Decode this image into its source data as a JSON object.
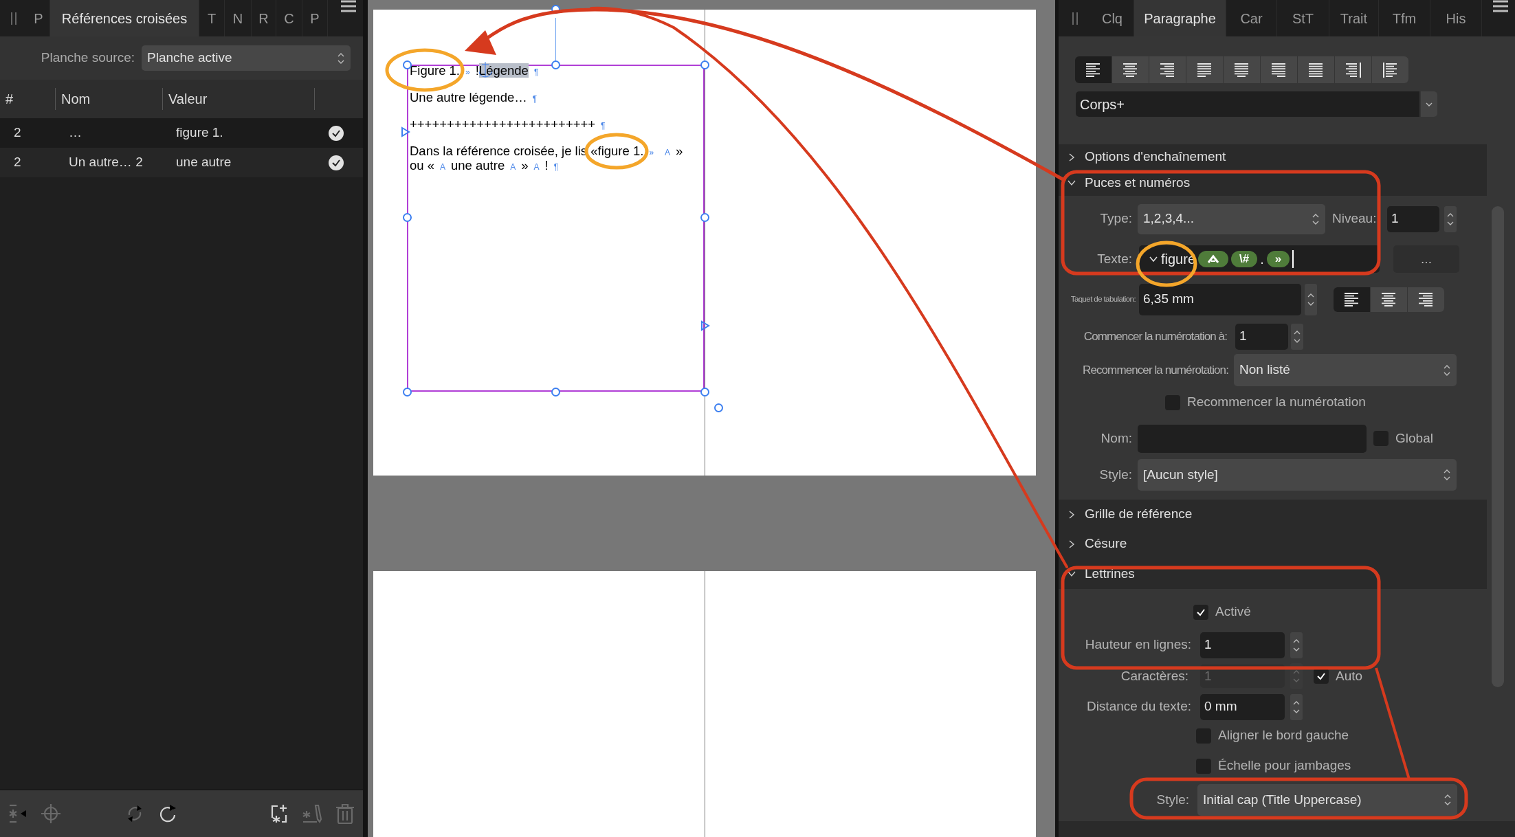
{
  "left_panel": {
    "tabs": [
      {
        "label": "P",
        "selected": false
      },
      {
        "label": "Références croisées",
        "selected": true
      },
      {
        "label": "T",
        "selected": false
      },
      {
        "label": "N",
        "selected": false
      },
      {
        "label": "R",
        "selected": false
      },
      {
        "label": "C",
        "selected": false
      },
      {
        "label": "P",
        "selected": false
      }
    ],
    "source": {
      "label": "Planche source:",
      "value": "Planche active"
    },
    "table": {
      "columns": [
        "#",
        "Nom",
        "Valeur"
      ],
      "rows": [
        {
          "cells": [
            "2",
            "…",
            "figure 1."
          ]
        },
        {
          "cells": [
            "2",
            "Un autre… 2",
            "une autre"
          ]
        }
      ]
    },
    "toolbar": [
      {
        "items": [
          {
            "kind": "insert",
            "disabled": true
          },
          {
            "kind": "target",
            "disabled": true
          }
        ]
      },
      {
        "items": [
          {
            "kind": "sync",
            "disabled": true
          },
          {
            "kind": "refresh",
            "disabled": false
          }
        ]
      },
      {
        "items": [
          {
            "kind": "add",
            "disabled": false
          },
          {
            "kind": "edit",
            "disabled": true
          },
          {
            "kind": "delete",
            "disabled": true
          }
        ]
      }
    ]
  },
  "canvas": {
    "paragraphs": [
      {
        "lines": [
          [
            {
              "kind": "text",
              "text": "Figure 1."
            },
            {
              "kind": "mark",
              "text": "»"
            },
            {
              "kind": "text",
              "text": "!"
            },
            {
              "kind": "highlight",
              "text": "Légende"
            },
            {
              "kind": "mark",
              "text": "¶"
            }
          ]
        ]
      },
      {
        "lines": [
          [
            {
              "kind": "text",
              "text": "Une autre légende…"
            },
            {
              "kind": "mark",
              "text": "¶"
            }
          ]
        ]
      },
      {
        "lines": [
          [
            {
              "kind": "text",
              "text": "+++++++++++++++++++++++++"
            },
            {
              "kind": "mark",
              "text": "¶"
            }
          ]
        ]
      },
      {
        "lines": [
          [
            {
              "kind": "text",
              "text": "Dans la référence croisée, je lis «figure 1."
            },
            {
              "kind": "mark",
              "text": "»"
            },
            {
              "kind": "mark",
              "text": "A"
            },
            {
              "kind": "text",
              "text": "»"
            }
          ],
          [
            {
              "kind": "text",
              "text": "ou «"
            },
            {
              "kind": "mark",
              "text": "A"
            },
            {
              "kind": "text",
              "text": "une autre"
            },
            {
              "kind": "mark",
              "text": "A"
            },
            {
              "kind": "text",
              "text": "»"
            },
            {
              "kind": "mark",
              "text": "A"
            },
            {
              "kind": "text",
              "text": "!"
            },
            {
              "kind": "mark",
              "text": "¶"
            }
          ]
        ]
      }
    ]
  },
  "right_panel": {
    "tabs": [
      {
        "label": "Clq",
        "selected": false
      },
      {
        "label": "Paragraphe",
        "selected": true
      },
      {
        "label": "Car",
        "selected": false
      },
      {
        "label": "StT",
        "selected": false
      },
      {
        "label": "Trait",
        "selected": false
      },
      {
        "label": "Tfm",
        "selected": false
      },
      {
        "label": "His",
        "selected": false
      }
    ],
    "alignment": [
      {
        "kind": "left",
        "selected": true
      },
      {
        "kind": "center",
        "selected": false
      },
      {
        "kind": "right",
        "selected": false
      },
      {
        "kind": "justify-left",
        "selected": false
      },
      {
        "kind": "justify-center",
        "selected": false
      },
      {
        "kind": "justify-right",
        "selected": false
      },
      {
        "kind": "justify-all",
        "selected": false
      },
      {
        "kind": "towards-spine",
        "selected": false
      },
      {
        "kind": "away-from-spine",
        "selected": false
      }
    ],
    "paragraph_style": "Corps+",
    "sections": [
      {
        "title": "Options d'enchaînement",
        "expanded": false
      },
      {
        "title": "Puces et numéros",
        "expanded": true,
        "kind": "bullets"
      },
      {
        "title": "Grille de référence",
        "expanded": false
      },
      {
        "title": "Césure",
        "expanded": false
      },
      {
        "title": "Lettrines",
        "expanded": true,
        "kind": "dropcaps"
      }
    ],
    "bullets": {
      "type": {
        "label": "Type:",
        "value": "1,2,3,4..."
      },
      "level": {
        "label": "Niveau:",
        "value": "1"
      },
      "text": {
        "label": "Texte:",
        "parts": [
          {
            "kind": "text",
            "text": "figure"
          },
          {
            "kind": "field-token"
          },
          {
            "kind": "token",
            "text": "\\#"
          },
          {
            "kind": "text",
            "text": "."
          },
          {
            "kind": "token",
            "text": "»"
          }
        ],
        "more": "..."
      },
      "tab_stop": {
        "label": "Taquet de tabulation:",
        "value": "6,35 mm",
        "alignment": [
          {
            "kind": "left",
            "selected": true
          },
          {
            "kind": "center",
            "selected": false
          },
          {
            "kind": "right",
            "selected": false
          }
        ]
      },
      "start": {
        "label": "Commencer la numérotation à:",
        "value": "1"
      },
      "restart": {
        "label": "Recommencer la numérotation:",
        "value": "Non listé"
      },
      "restart_check": {
        "label": "Recommencer la numérotation",
        "checked": false
      },
      "name": {
        "label": "Nom:"
      },
      "global": {
        "label": "Global",
        "checked": false
      },
      "style": {
        "label": "Style:",
        "value": "[Aucun style]"
      }
    },
    "dropcaps": {
      "enabled": {
        "label": "Activé",
        "checked": true
      },
      "height": {
        "label": "Hauteur en lignes:",
        "value": "1"
      },
      "chars": {
        "label": "Caractères:",
        "value": "1",
        "disabled": true
      },
      "auto": {
        "label": "Auto",
        "checked": true
      },
      "distance": {
        "label": "Distance du texte:",
        "value": "0 mm"
      },
      "align_left": {
        "label": "Aligner le bord gauche",
        "checked": false
      },
      "scale": {
        "label": "Échelle pour jambages",
        "checked": false
      },
      "style": {
        "label": "Style:",
        "value": "Initial cap (Title Uppercase)"
      }
    }
  }
}
